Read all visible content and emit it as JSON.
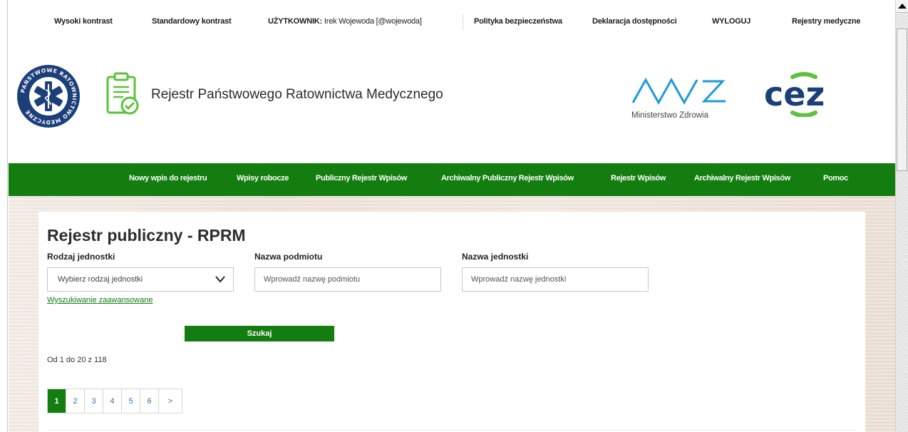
{
  "top_bar": {
    "high_contrast": "Wysoki kontrast",
    "standard_contrast": "Standardowy kontrast",
    "user_label": "UŻYTKOWNIK:",
    "user_name": "Irek Wojewoda [@wojewoda]",
    "security_policy": "Polityka bezpieczeństwa",
    "accessibility": "Deklaracja dostępności",
    "logout": "WYLOGUJ",
    "medical_registers": "Rejestry medyczne"
  },
  "header": {
    "title": "Rejestr Państwowego Ratownictwa Medycznego",
    "emblem_text": "PAŃSTWOWE RATOWNICTWO MEDYCZNE",
    "ministry_text": "Ministerstwo Zdrowia",
    "cez_text": "cez"
  },
  "nav": {
    "items": [
      "Nowy wpis do rejestru",
      "Wpisy robocze",
      "Publiczny Rejestr Wpisów",
      "Archiwalny Publiczny Rejestr Wpisów",
      "Rejestr Wpisów",
      "Archiwalny Rejestr Wpisów",
      "Pomoc"
    ]
  },
  "main": {
    "title": "Rejestr publiczny - RPRM",
    "filters": {
      "unit_type_label": "Rodzaj jednostki",
      "unit_type_value": "Wybierz rodzaj jednostki",
      "entity_name_label": "Nazwa podmiotu",
      "entity_name_placeholder": "Wprowadź nazwę podmiotu",
      "unit_name_label": "Nazwa jednostki",
      "unit_name_placeholder": "Wprowadź nazwę jednostki"
    },
    "advanced_search": "Wyszukiwanie zaawansowane",
    "search_button": "Szukaj",
    "results_text": "Od 1 do 20 z 118",
    "pagination": [
      "1",
      "2",
      "3",
      "4",
      "5",
      "6",
      ">"
    ],
    "current_page": 1
  },
  "colors": {
    "brand_green": "#137d0f",
    "cez_green": "#5cc23c",
    "cez_blue": "#1c3f7a",
    "mz_blue": "#1e9ad6",
    "emblem_blue": "#1c3f7a"
  }
}
